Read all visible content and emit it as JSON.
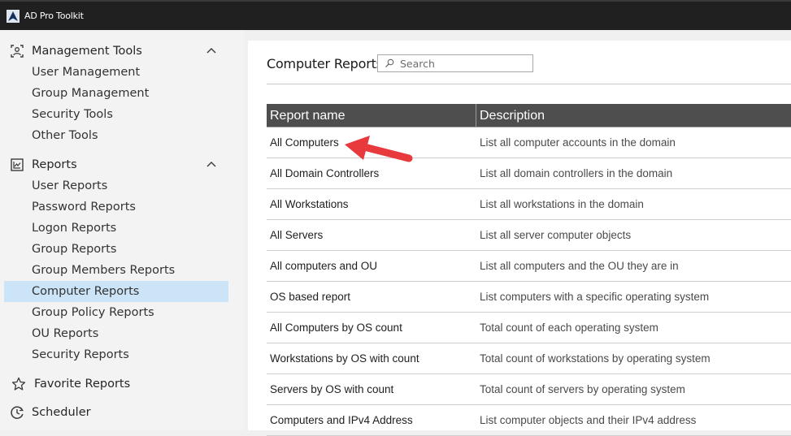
{
  "app": {
    "title": "AD Pro Toolkit"
  },
  "sidebar": {
    "groups": [
      {
        "label": "Management Tools",
        "icon": "user-scan-icon",
        "expanded": true,
        "items": [
          {
            "label": "User Management"
          },
          {
            "label": "Group Management"
          },
          {
            "label": "Security Tools"
          },
          {
            "label": "Other Tools"
          }
        ]
      },
      {
        "label": "Reports",
        "icon": "chart-icon",
        "expanded": true,
        "items": [
          {
            "label": "User Reports"
          },
          {
            "label": "Password Reports"
          },
          {
            "label": "Logon Reports"
          },
          {
            "label": "Group Reports"
          },
          {
            "label": "Group Members Reports"
          },
          {
            "label": "Computer Reports",
            "active": true
          },
          {
            "label": "Group Policy Reports"
          },
          {
            "label": "OU Reports"
          },
          {
            "label": "Security Reports"
          }
        ]
      },
      {
        "label": "Favorite Reports",
        "icon": "star-icon"
      },
      {
        "label": "Scheduler",
        "icon": "clock-icon"
      }
    ]
  },
  "main": {
    "title": "Computer Reports",
    "search": {
      "placeholder": "Search",
      "value": ""
    },
    "table": {
      "columns": [
        "Report name",
        "Description"
      ],
      "rows": [
        {
          "name": "All Computers",
          "description": "List all computer accounts in the domain"
        },
        {
          "name": "All Domain Controllers",
          "description": "List all domain controllers in the domain"
        },
        {
          "name": "All Workstations",
          "description": "List all workstations in the domain"
        },
        {
          "name": "All Servers",
          "description": "List all server computer objects"
        },
        {
          "name": "All computers and OU",
          "description": "List all computers and the OU they are in"
        },
        {
          "name": "OS based report",
          "description": "List computers with a specific operating system"
        },
        {
          "name": "All Computers by OS count",
          "description": "Total count of each operating system"
        },
        {
          "name": "Workstations by OS with count",
          "description": "Total count of workstations by operating system"
        },
        {
          "name": "Servers by OS with count",
          "description": "Total count of servers by operating system"
        },
        {
          "name": "Computers and IPv4 Address",
          "description": "List computer objects and their IPv4 address"
        }
      ]
    }
  },
  "annotation": {
    "arrow_color": "#e8393c",
    "points_to": "All Computers"
  },
  "colors": {
    "titlebar": "#202020",
    "sidebar_bg": "#f3f3f3",
    "active_item": "#cce4f7",
    "table_header": "#4e4e4e"
  }
}
